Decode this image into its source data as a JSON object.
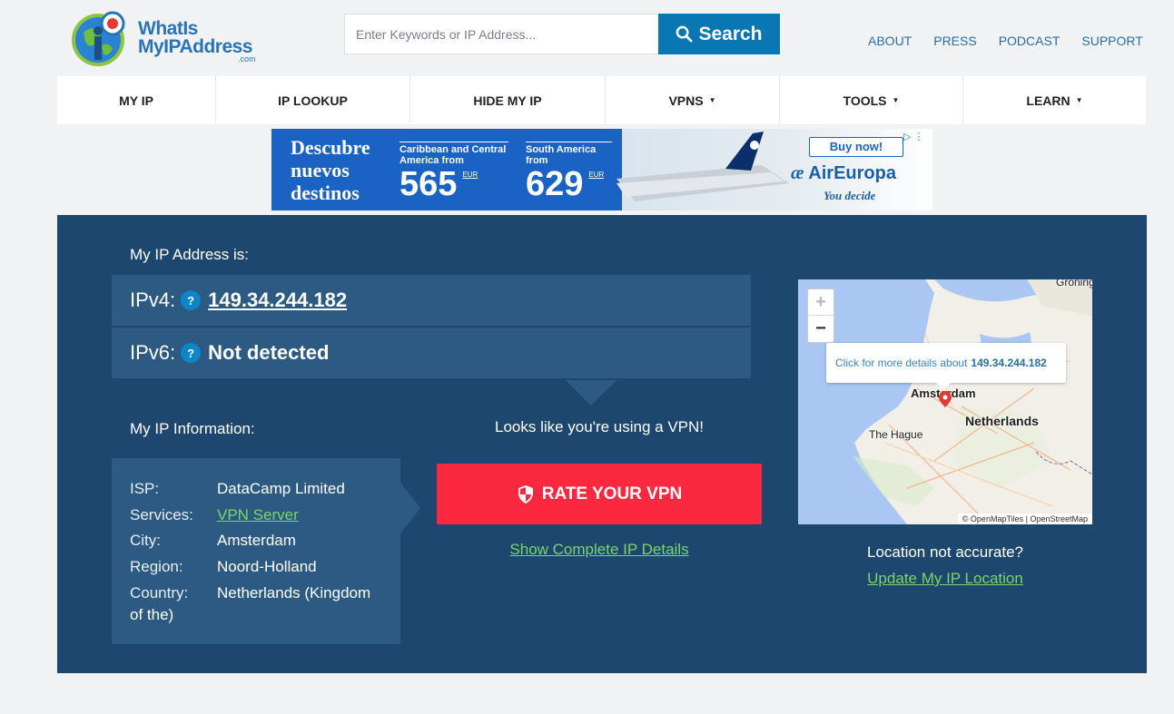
{
  "header": {
    "logo_line1": "WhatIs",
    "logo_line2": "MyIPAddress",
    "logo_suffix": ".com",
    "search_placeholder": "Enter Keywords or IP Address...",
    "search_button": "Search",
    "top_links": [
      "ABOUT",
      "PRESS",
      "PODCAST",
      "SUPPORT"
    ]
  },
  "nav": {
    "items": [
      {
        "label": "MY IP",
        "dropdown": false
      },
      {
        "label": "IP LOOKUP",
        "dropdown": false
      },
      {
        "label": "HIDE MY IP",
        "dropdown": false
      },
      {
        "label": "VPNS",
        "dropdown": true
      },
      {
        "label": "TOOLS",
        "dropdown": true
      },
      {
        "label": "LEARN",
        "dropdown": true
      }
    ],
    "caret": "▼"
  },
  "ad": {
    "headline": [
      "Descubre",
      "nuevos",
      "destinos"
    ],
    "offer1_label": "Caribbean and Central America from",
    "offer1_price": "565",
    "offer1_currency": "EUR",
    "offer2_label": "South America from",
    "offer2_price": "629",
    "offer2_currency": "EUR",
    "cta": "Buy now!",
    "brand": "AirEuropa",
    "slogan": "You decide"
  },
  "ip": {
    "heading": "My IP Address is:",
    "ipv4_label": "IPv4:",
    "ipv4_value": "149.34.244.182",
    "ipv6_label": "IPv6:",
    "ipv6_value": "Not detected",
    "help_glyph": "?"
  },
  "info": {
    "heading": "My IP Information:",
    "rows": [
      {
        "key": "ISP:",
        "value": "DataCamp Limited"
      },
      {
        "key": "Services:",
        "value": "VPN Server"
      },
      {
        "key": "City:",
        "value": "Amsterdam"
      },
      {
        "key": "Region:",
        "value": "Noord-Holland"
      },
      {
        "key": "Country:",
        "value": "Netherlands (Kingdom"
      }
    ],
    "country_wrap": "of the)"
  },
  "vpn": {
    "message": "Looks like you're using a VPN!",
    "rate_button": "RATE YOUR VPN",
    "details_link": "Show Complete IP Details"
  },
  "map": {
    "zoom_in": "+",
    "zoom_out": "−",
    "popup_text": "Click for more details about",
    "popup_ip": "149.34.244.182",
    "label_amsterdam": "Amsterdam",
    "label_netherlands": "Netherlands",
    "label_hague": "The Hague",
    "label_groningen": "Groning",
    "attribution": "© OpenMapTiles | OpenStreetMap"
  },
  "location": {
    "question": "Location not accurate?",
    "update_link": "Update My IP Location"
  }
}
